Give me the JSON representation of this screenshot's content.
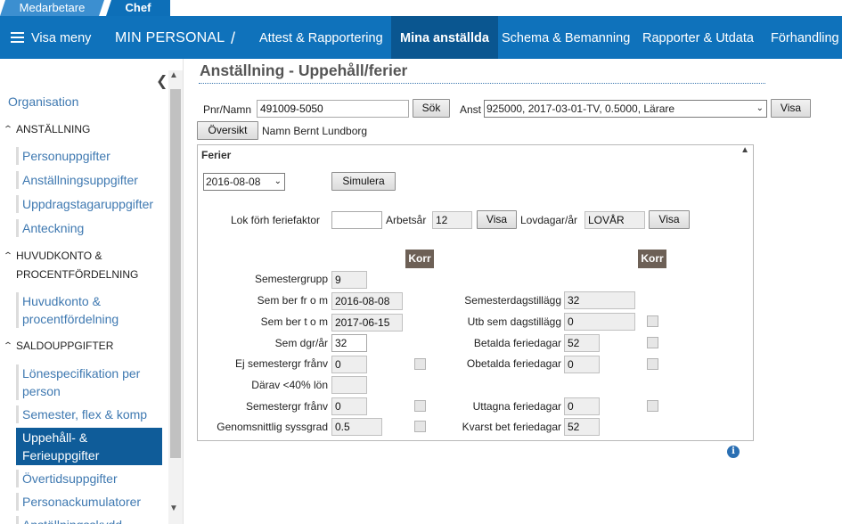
{
  "role_tabs": {
    "employee": "Medarbetare",
    "manager": "Chef"
  },
  "nav": {
    "menu": "Visa meny",
    "title": "MIN PERSONAL",
    "separator": "/",
    "items": [
      "Attest & Rapportering",
      "Mina anställda",
      "Schema & Bemanning",
      "Rapporter & Utdata",
      "Förhandling"
    ],
    "active_item": "Mina anställda"
  },
  "sidebar": {
    "organisation": "Organisation",
    "sections": [
      {
        "label": "ANSTÄLLNING",
        "items": [
          "Personuppgifter",
          "Anställningsuppgifter",
          "Uppdragstagaruppgifter",
          "Anteckning"
        ]
      },
      {
        "label_lines": [
          "HUVUDKONTO &",
          "PROCENTFÖRDELNING"
        ],
        "items": [
          [
            "Huvudkonto &",
            "procentfördelning"
          ]
        ]
      },
      {
        "label": "SALDOUPPGIFTER",
        "items": [
          [
            "Lönespecifikation per",
            "person"
          ],
          "Semester, flex & komp",
          [
            "Uppehåll- &",
            "Ferieuppgifter"
          ],
          "Övertidsuppgifter",
          "Personackumulatorer",
          "Anställningsskydd..."
        ]
      }
    ],
    "current_item": "Uppehåll- & Ferieuppgifter"
  },
  "page": {
    "title": "Anställning - Uppehåll/ferier",
    "pnr_label": "Pnr/Namn",
    "pnr_value": "491009-5050",
    "search_button": "Sök",
    "anst_label": "Anst",
    "anst_value": "925000, 2017-03-01-TV, 0.5000, Lärare",
    "show_button": "Visa",
    "overview_button": "Översikt",
    "name_text": "Namn Bernt Lundborg"
  },
  "ferier": {
    "title": "Ferier",
    "date_value": "2016-08-08",
    "simulate_button": "Simulera",
    "lok_label": "Lok förh feriefaktor",
    "lok_value": "",
    "arbetsar_label": "Arbetsår",
    "arbetsar_value": "12",
    "arbetsar_button": "Visa",
    "lovdagar_label": "Lovdagar/år",
    "lovdagar_value": "LOVÅR",
    "lovdagar_button": "Visa",
    "korr_label": "Korr",
    "left_fields": [
      {
        "label": "Semestergrupp",
        "value": "9"
      },
      {
        "label": "Sem ber fr o m",
        "value": "2016-08-08"
      },
      {
        "label": "Sem ber t o m",
        "value": "2017-06-15"
      },
      {
        "label": "Sem dgr/år",
        "value": "32"
      },
      {
        "label": "Ej semestergr frånv",
        "value": "0"
      },
      {
        "label": "Därav <40% lön",
        "value": ""
      },
      {
        "label": "Semestergr frånv",
        "value": "0"
      },
      {
        "label": "Genomsnittlig syssgrad",
        "value": "0.5"
      }
    ],
    "right_fields": [
      {
        "label": "Semesterdagstillägg",
        "value": "32"
      },
      {
        "label": "Utb sem dagstillägg",
        "value": "0"
      },
      {
        "label": "Betalda feriedagar",
        "value": "52"
      },
      {
        "label": "Obetalda feriedagar",
        "value": "0"
      },
      {
        "label": "Uttagna feriedagar",
        "value": "0"
      },
      {
        "label": "Kvarst bet feriedagar",
        "value": "52"
      }
    ]
  },
  "icons": {
    "info": "info-icon",
    "collapse_sidebar": "chevron-left-icon",
    "menu": "hamburger-icon"
  },
  "colors": {
    "nav_bg": "#0f72bb",
    "nav_active": "#0a5690",
    "sidebar_current": "#0f5c99",
    "korr_bg": "#6d6056"
  }
}
